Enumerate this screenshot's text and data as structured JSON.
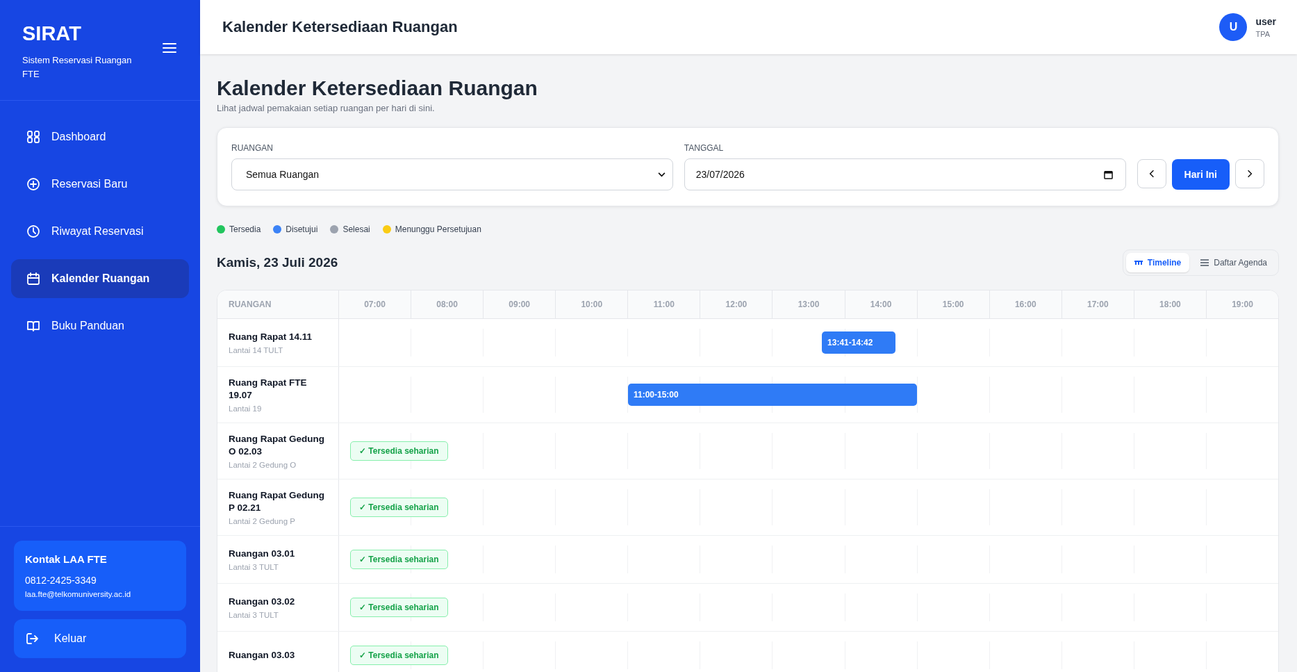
{
  "sidebar": {
    "brand": "SIRAT",
    "tagline": "Sistem Reservasi Ruangan FTE",
    "items": [
      {
        "label": "Dashboard",
        "kind": "grid",
        "selected": false
      },
      {
        "label": "Reservasi Baru",
        "kind": "plus",
        "selected": false
      },
      {
        "label": "Riwayat Reservasi",
        "kind": "clock",
        "selected": false
      },
      {
        "label": "Kalender Ruangan",
        "kind": "calendar",
        "selected": true
      },
      {
        "label": "Buku Panduan",
        "kind": "book",
        "selected": false
      }
    ],
    "contact": {
      "title": "Kontak LAA FTE",
      "phone": "0812-2425-3349",
      "email": "laa.fte@telkomuniversity.ac.id"
    },
    "logout": "Keluar"
  },
  "header": {
    "title": "Kalender Ketersediaan Ruangan",
    "avatar": "U",
    "user": "user",
    "role": "TPA"
  },
  "page": {
    "title": "Kalender Ketersediaan Ruangan",
    "subtitle": "Lihat jadwal pemakaian setiap ruangan per hari di sini."
  },
  "filters": {
    "room_label": "RUANGAN",
    "room_value": "Semua Ruangan",
    "date_label": "TANGGAL",
    "date_value": "23/07/2026",
    "today_button": "Hari Ini"
  },
  "legend": [
    {
      "label": "Tersedia",
      "color": "#22c55e"
    },
    {
      "label": "Disetujui",
      "color": "#3b82f6"
    },
    {
      "label": "Selesai",
      "color": "#9ca3af"
    },
    {
      "label": "Menunggu Persetujuan",
      "color": "#facc15"
    }
  ],
  "date_heading": "Kamis, 23 Juli 2026",
  "views": [
    {
      "label": "Timeline",
      "kind": "timeline",
      "selected": true
    },
    {
      "label": "Daftar Agenda",
      "kind": "list",
      "selected": false
    }
  ],
  "timeline": {
    "room_header": "RUANGAN",
    "hours": [
      "07:00",
      "08:00",
      "09:00",
      "10:00",
      "11:00",
      "12:00",
      "13:00",
      "14:00",
      "15:00",
      "16:00",
      "17:00",
      "18:00",
      "19:00"
    ],
    "rows": [
      {
        "name": "Ruang Rapat 14.11",
        "floor": "Lantai 14 TULT",
        "kind": "booked",
        "bookings": [
          {
            "time": "13:41-14:42"
          }
        ]
      },
      {
        "name": "Ruang Rapat FTE 19.07",
        "floor": "Lantai 19",
        "kind": "booked",
        "bookings": [
          {
            "time": "11:00-15:00"
          }
        ]
      },
      {
        "name": "Ruang Rapat Gedung O 02.03",
        "floor": "Lantai 2 Gedung O",
        "kind": "available",
        "badge": "✓ Tersedia seharian"
      },
      {
        "name": "Ruang Rapat Gedung P 02.21",
        "floor": "Lantai 2 Gedung P",
        "kind": "available",
        "badge": "✓ Tersedia seharian"
      },
      {
        "name": "Ruangan 03.01",
        "floor": "Lantai 3 TULT",
        "kind": "available",
        "badge": "✓ Tersedia seharian"
      },
      {
        "name": "Ruangan 03.02",
        "floor": "Lantai 3 TULT",
        "kind": "available",
        "badge": "✓ Tersedia seharian"
      },
      {
        "name": "Ruangan 03.03",
        "kind": "available",
        "badge": "✓ Tersedia seharian"
      }
    ]
  }
}
